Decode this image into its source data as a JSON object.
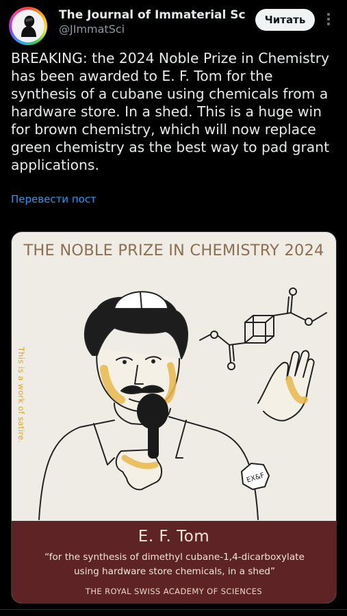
{
  "author": {
    "display_name": "The Journal of Immaterial Scie...",
    "handle": "@JImmatSci",
    "avatar_icon": "rainbow-ring-avatar"
  },
  "follow_button": {
    "label": "Читать"
  },
  "more_menu_icon": "vertical-ellipsis-icon",
  "post": {
    "lines": [
      "BREAKING: the 2024 Noble Prize in Chemistry",
      "has been awarded to E. F. Tom for the",
      "synthesis of a cubane using chemicals from a",
      "hardware store. In a shed. This is a huge win",
      "for brown chemistry, which will now replace",
      "green chemistry as the best way to pad grant",
      "applications."
    ],
    "translate_link": "Перевести пост"
  },
  "media": {
    "title": "THE NOBLE PRIZE IN CHEMISTRY 2024",
    "side_note": "This is a work of satire.",
    "badge_text": "EX&F",
    "laureate": "E. F. Tom",
    "citation_lines": [
      "“for the synthesis of dimethyl cubane-1,4-dicarboxylate",
      "using hardware store chemicals, in a shed”"
    ],
    "academy": "THE ROYAL SWISS ACADEMY OF SCIENCES"
  },
  "colors": {
    "background": "#000000",
    "text": "#e7e9ea",
    "link": "#1d9bf0",
    "card_bg": "#eeece4",
    "card_title": "#8a7050",
    "accent_yellow": "#f2cd6b",
    "footer_bg": "#5e2325"
  }
}
